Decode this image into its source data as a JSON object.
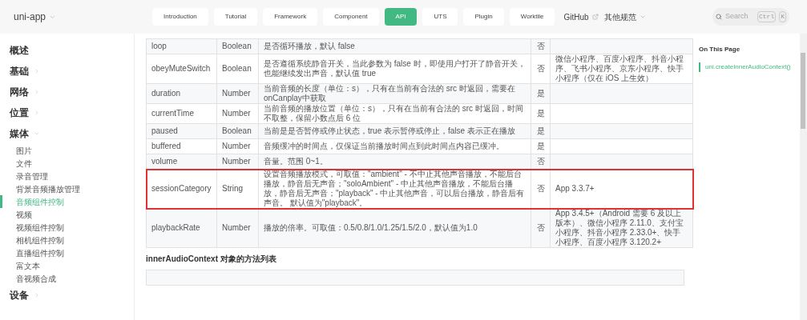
{
  "header": {
    "logo": "uni-app",
    "nav": [
      {
        "label": "Introduction",
        "selected": false
      },
      {
        "label": "Tutorial",
        "selected": false
      },
      {
        "label": "Framework",
        "selected": false
      },
      {
        "label": "Component",
        "selected": false
      },
      {
        "label": "API",
        "selected": true
      },
      {
        "label": "UTS",
        "selected": false
      },
      {
        "label": "Plugin",
        "selected": false
      },
      {
        "label": "Worktile",
        "selected": false
      }
    ],
    "links": [
      {
        "label": "GitHub",
        "kind": "external"
      },
      {
        "label": "其他规范",
        "kind": "dropdown"
      }
    ],
    "search": {
      "placeholder": "Search",
      "keys": [
        "Ctrl",
        "K"
      ]
    }
  },
  "sidebar": {
    "items": [
      {
        "label": "概述"
      },
      {
        "label": "基础",
        "expanded": false
      },
      {
        "label": "网络",
        "expanded": false
      },
      {
        "label": "位置",
        "expanded": false
      },
      {
        "label": "媒体",
        "expanded": true,
        "children": [
          {
            "label": "图片",
            "selected": false
          },
          {
            "label": "文件",
            "selected": false
          },
          {
            "label": "录音管理",
            "selected": false
          },
          {
            "label": "背景音频播放管理",
            "selected": false
          },
          {
            "label": "音频组件控制",
            "selected": true
          },
          {
            "label": "视频",
            "selected": false
          },
          {
            "label": "视频组件控制",
            "selected": false
          },
          {
            "label": "相机组件控制",
            "selected": false
          },
          {
            "label": "直播组件控制",
            "selected": false
          },
          {
            "label": "富文本",
            "selected": false
          },
          {
            "label": "音视频合成",
            "selected": false
          }
        ]
      },
      {
        "label": "设备",
        "expanded": false
      }
    ]
  },
  "table": {
    "rows": [
      {
        "name": "loop",
        "type": "Boolean",
        "description": "是否循环播放，默认 false",
        "required": "否",
        "platform": "",
        "highlighted": false
      },
      {
        "name": "obeyMuteSwitch",
        "type": "Boolean",
        "description": "是否遵循系统静音开关，当此参数为 false 时，即使用户打开了静音开关，也能继续发出声音，默认值 true",
        "required": "否",
        "platform": "微信小程序、百度小程序、抖音小程序、飞书小程序、京东小程序、快手小程序（仅在 iOS 上生效）",
        "highlighted": false
      },
      {
        "name": "duration",
        "type": "Number",
        "description": "当前音频的长度（单位：s），只有在当前有合法的 src 时返回，需要在 onCanplay中获取",
        "required": "是",
        "platform": "",
        "highlighted": false
      },
      {
        "name": "currentTime",
        "type": "Number",
        "description": "当前音频的播放位置（单位：s），只有在当前有合法的 src 时返回，时间不取整，保留小数点后 6 位",
        "required": "是",
        "platform": "",
        "highlighted": false
      },
      {
        "name": "paused",
        "type": "Boolean",
        "description": "当前是是否暂停或停止状态，true 表示暂停或停止，false 表示正在播放",
        "required": "是",
        "platform": "",
        "highlighted": false
      },
      {
        "name": "buffered",
        "type": "Number",
        "description": "音频缓冲的时间点，仅保证当前播放时间点到此时间点内容已缓冲。",
        "required": "是",
        "platform": "",
        "highlighted": false
      },
      {
        "name": "volume",
        "type": "Number",
        "description": "音量。范围 0~1。",
        "required": "否",
        "platform": "",
        "highlighted": false
      },
      {
        "name": "sessionCategory",
        "type": "String",
        "description": "设置音频播放模式，可取值：\"ambient\" - 不中止其他声音播放，不能后台播放，静音后无声音；\"soloAmbient\" - 中止其他声音播放，不能后台播放，静音后无声音；\"playback\" - 中止其他声音，可以后台播放，静音后有声音。 默认值为\"playback\"。",
        "required": "否",
        "platform": "App 3.3.7+",
        "highlighted": true
      },
      {
        "name": "playbackRate",
        "type": "Number",
        "description": "播放的倍率。可取值：0.5/0.8/1.0/1.25/1.5/2.0，默认值为1.0",
        "required": "否",
        "platform": "App 3.4.5+（Android 需要 6 及以上版本）、微信小程序 2.11.0、支付宝小程序、抖音小程序 2.33.0+、快手小程序、百度小程序 3.120.2+",
        "highlighted": false
      }
    ]
  },
  "methods_heading": "innerAudioContext 对象的方法列表",
  "outline": {
    "title": "On This Page",
    "links": [
      {
        "label": "uni.createInnerAudioContext()",
        "selected": true
      }
    ]
  }
}
